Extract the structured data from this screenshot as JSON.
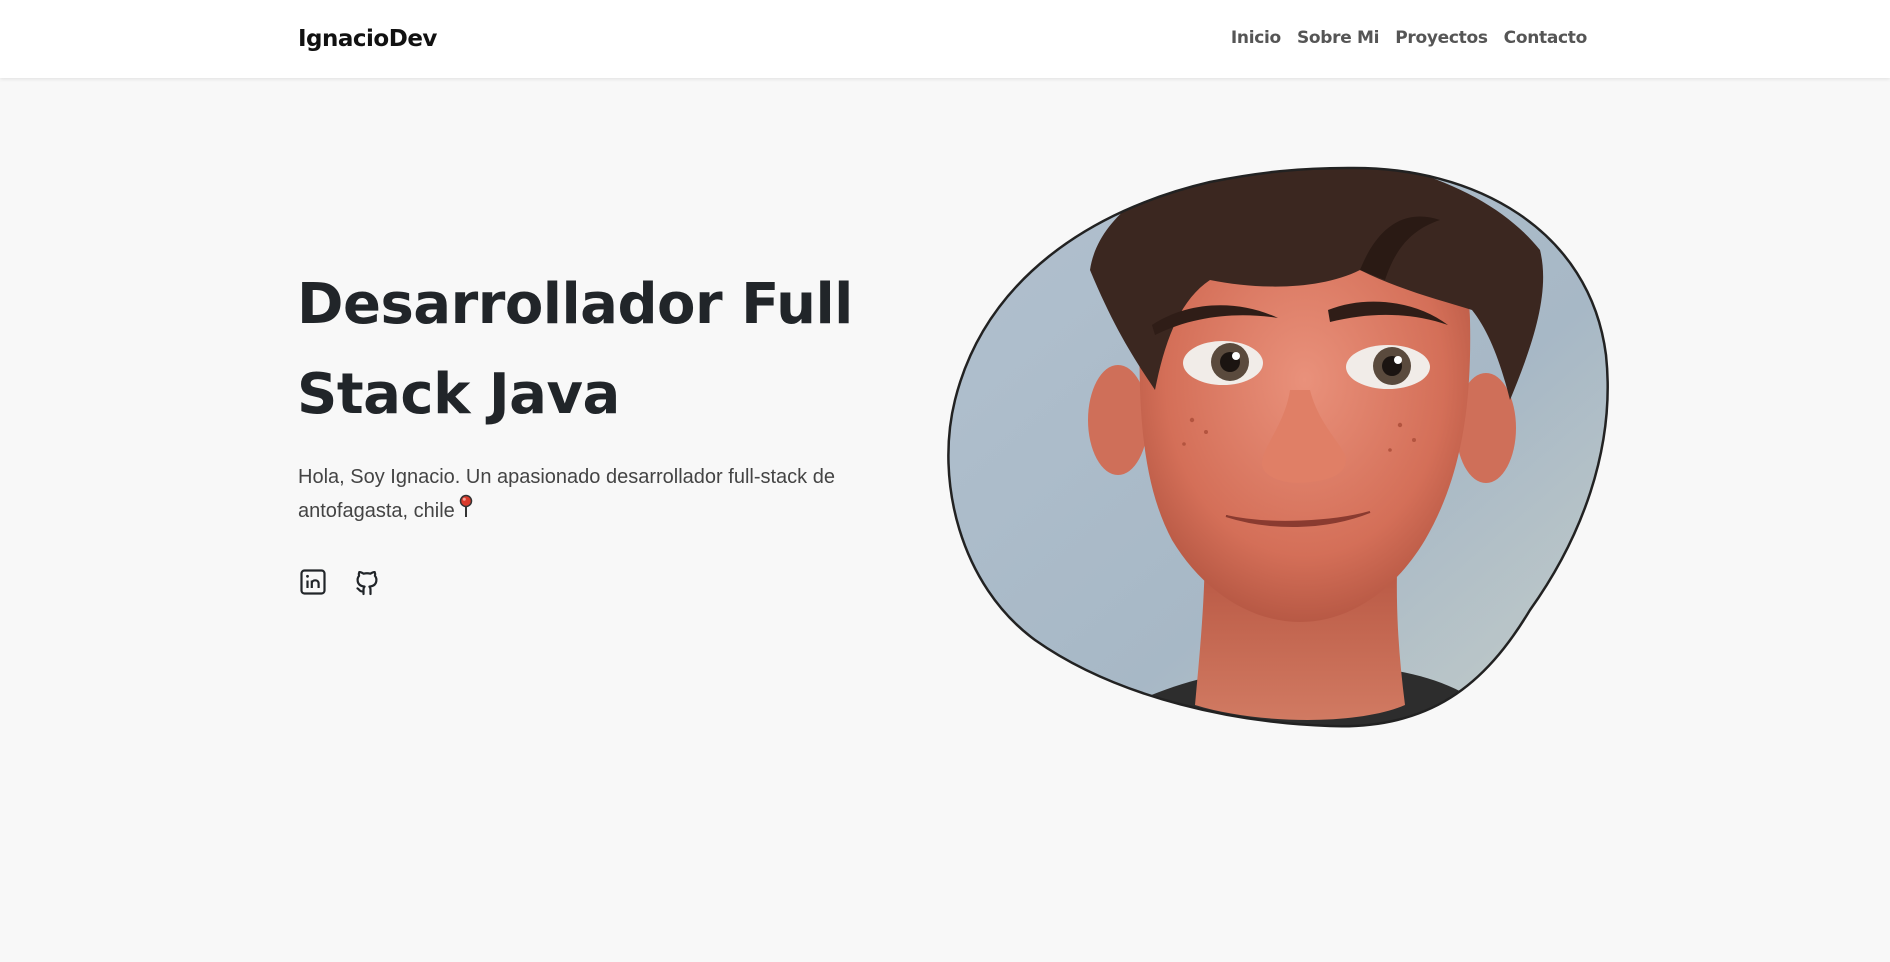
{
  "navbar": {
    "brand": "IgnacioDev",
    "links": [
      "Inicio",
      "Sobre Mi",
      "Proyectos",
      "Contacto"
    ]
  },
  "hero": {
    "title": "Desarrollador Full Stack Java",
    "description": "Hola, Soy Ignacio. Un apasionado desarrollador full-stack de antofagasta, chile",
    "socials": [
      "linkedin-icon",
      "github-icon"
    ]
  },
  "portrait": {
    "alt": "cartoon portrait"
  },
  "colors": {
    "background": "#f8f8f8",
    "navbar": "#ffffff",
    "text": "#212529",
    "muted": "#444444",
    "pin": "#d93a2b"
  }
}
